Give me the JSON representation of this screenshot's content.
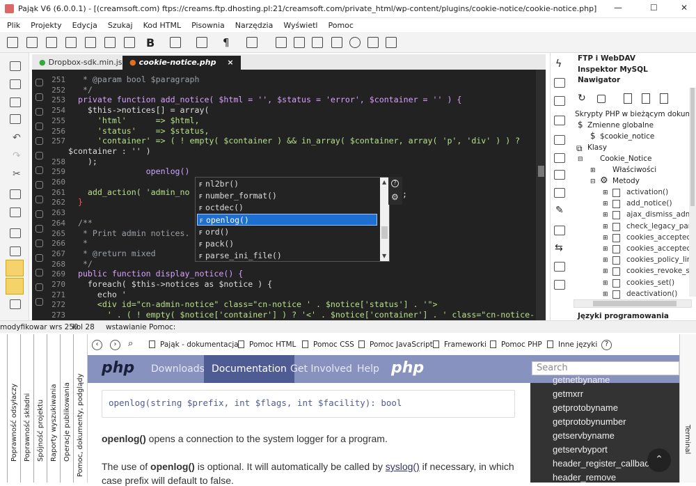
{
  "window": {
    "title": "Pająk V6 (6.0.0.1) - [(creamsoft.com) ftps://creams.ftp.dhosting.pl:21/creamsoft.com/private_html/wp-content/plugins/cookie-notice/cookie-notice.php]",
    "minimize": "—",
    "maximize": "☐",
    "close": "✕"
  },
  "menu": [
    "Plik",
    "Projekty",
    "Edycja",
    "Szukaj",
    "Kod HTML",
    "Pisownia",
    "Narzędzia",
    "Wyświetl",
    "Pomoc"
  ],
  "tabs": [
    {
      "label": "Dropbox-sdk.min.js"
    },
    {
      "label": "cookie-notice.php"
    }
  ],
  "editor": {
    "lines": [
      {
        "n": "251",
        "c": "   * @param bool $paragraph"
      },
      {
        "n": "252",
        "c": "   */"
      },
      {
        "n": "253",
        "c": "  private function add_notice( $html = '', $status = 'error', $container = '' ) {"
      },
      {
        "n": "254",
        "c": "    $this->notices[] = array("
      },
      {
        "n": "255",
        "c": "      'html'      => $html,"
      },
      {
        "n": "256",
        "c": "      'status'    => $status,"
      },
      {
        "n": "257",
        "c": "      'container' => ( ! empty( $container ) && in_array( $container, array( 'p', 'div' ) ) ?"
      },
      {
        "n": "",
        "c": "$container : '' )"
      },
      {
        "n": "258",
        "c": "    );"
      },
      {
        "n": "259",
        "c": "                openlog()"
      },
      {
        "n": "260",
        "c": ""
      },
      {
        "n": "261",
        "c": "    add_action( 'admin_no"
      },
      {
        "n": "262",
        "c": "  }"
      },
      {
        "n": "263",
        "c": ""
      },
      {
        "n": "264",
        "c": "  /**"
      },
      {
        "n": "265",
        "c": "   * Print admin notices."
      },
      {
        "n": "266",
        "c": "   *"
      },
      {
        "n": "267",
        "c": "   * @return mixed"
      },
      {
        "n": "268",
        "c": "   */"
      },
      {
        "n": "269",
        "c": "  public function display_notice() {"
      },
      {
        "n": "270",
        "c": "    foreach( $this->notices as $notice ) {"
      },
      {
        "n": "271",
        "c": "      echo '"
      },
      {
        "n": "272",
        "c": "      <div id=\"cn-admin-notice\" class=\"cn-notice ' . $notice['status'] . '\">"
      },
      {
        "n": "273",
        "c": "        ' . ( ! empty( $notice['container'] ) ? '<' . $notice['container'] . ' class=\"cn-notice-"
      }
    ]
  },
  "autocomplete": {
    "items": [
      "nl2br()",
      "number_format()",
      "octdec()",
      "openlog()",
      "ord()",
      "pack()",
      "parse_ini_file()"
    ],
    "selected": "openlog()",
    "suffix": ";"
  },
  "right_panel": {
    "headers": [
      "FTP i WebDAV",
      "Inspektor MySQL",
      "Nawigator"
    ],
    "footer": "Języki programowania",
    "tree": {
      "root": "Skrypty PHP w bieżącym dokumencie",
      "globals": "Zmienne globalne",
      "global_var": "$cookie_notice",
      "classes": "Klasy",
      "class": "Cookie_Notice",
      "props": "Właściwości",
      "methods": "Metody",
      "method_list": [
        "activation()",
        "add_notice()",
        "ajax_dismiss_admin",
        "check_legacy_paran",
        "cookies_accepted()",
        "cookies_accepted_s",
        "cookies_policy_link",
        "cookies_revoke_sho",
        "cookies_set()",
        "deactivation()"
      ]
    }
  },
  "status": {
    "mode": "modyfikowar wrs 259",
    "col": "kol 28",
    "insert": "wstawianie",
    "help": "Pomoc:"
  },
  "bottom_tabs": [
    "Poprawność odsyłaczy",
    "Poprawność składni",
    "Spójność projektu",
    "Raporty wyszukiwania",
    "Operacje publikowania",
    "Pomoc, dokumenty, podglądy"
  ],
  "help_nav": [
    "Pająk - dokumentacja",
    "Pomoc HTML",
    "Pomoc CSS",
    "Pomoc JavaScript",
    "Frameworki",
    "Pomoc PHP",
    "Inne języki"
  ],
  "php_site": {
    "logo": "php",
    "nav": [
      "Downloads",
      "Documentation",
      "Get Involved",
      "Help"
    ],
    "active": "Documentation",
    "logo_elephant": "php",
    "search_placeholder": "Search",
    "signature": "openlog(string $prefix, int $flags, int $facility): bool",
    "p1_bold": "openlog()",
    "p1_rest": " opens a connection to the system logger for a program.",
    "p2_a": "The use of ",
    "p2_bold": "openlog()",
    "p2_b": " is optional. It will automatically be called by ",
    "p2_link": "syslog()",
    "p2_c": " if necessary, in which",
    "p3": "case prefix will default to false.",
    "functions": [
      "getnetbyname",
      "getmxrr",
      "getprotobyname",
      "getprotobynumber",
      "getservbyname",
      "getservbyport",
      "header_register_callback",
      "header_remove"
    ]
  },
  "terminal": "Terminal"
}
